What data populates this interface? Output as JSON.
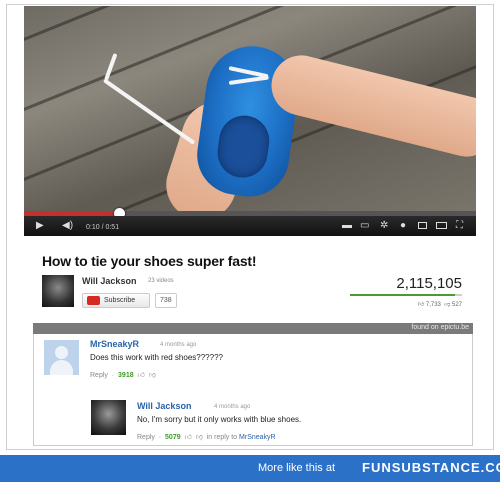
{
  "video": {
    "time": "0:10 / 0:51",
    "progress": 0.21
  },
  "title": "How to tie your shoes super fast!",
  "channel": {
    "name": "Will Jackson",
    "video_count": "23 videos",
    "subscribe_label": "Subscribe",
    "subscriber_count": "738"
  },
  "stats": {
    "views": "2,115,105",
    "likes": "7,733",
    "dislikes": "527",
    "like_ratio": 0.94
  },
  "watermark": "found on epictu.be",
  "comments": [
    {
      "author": "MrSneakyR",
      "time": "4 months ago",
      "text": "Does this work with red shoes??????",
      "reply_label": "Reply",
      "score": "3918"
    },
    {
      "author": "Will Jackson",
      "time": "4 months ago",
      "text": "No, I'm sorry but it only works with blue shoes.",
      "reply_label": "Reply",
      "score": "5079",
      "in_reply_to_prefix": "in reply to",
      "in_reply_to": "MrSneakyR"
    }
  ],
  "footer": {
    "text": "More like this at",
    "brand": "FUNSUBSTANCE.COM"
  },
  "colors": {
    "progress": "#c4302b",
    "link": "#2b64a8",
    "score": "#3f9a2c",
    "footer": "#2b71c8"
  },
  "icons": [
    "play-icon",
    "volume-icon",
    "captions-icon",
    "settings-icon",
    "theater-icon",
    "fullscreen-icon",
    "thumbs-up-icon",
    "thumbs-down-icon"
  ]
}
